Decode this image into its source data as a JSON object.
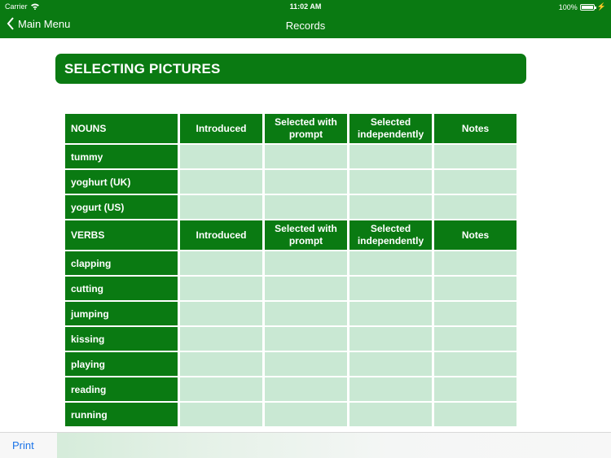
{
  "status": {
    "carrier": "Carrier",
    "time": "11:02 AM",
    "battery": "100%"
  },
  "nav": {
    "back_label": "Main Menu",
    "title": "Records"
  },
  "heading": "SELECTING PICTURES",
  "columns": [
    "Introduced",
    "Selected with prompt",
    "Selected independently",
    "Notes"
  ],
  "sections": [
    {
      "title": "NOUNS",
      "items": [
        "tummy",
        "yoghurt (UK)",
        "yogurt (US)"
      ]
    },
    {
      "title": "VERBS",
      "items": [
        "clapping",
        "cutting",
        "jumping",
        "kissing",
        "playing",
        "reading",
        "running"
      ]
    }
  ],
  "toolbar": {
    "print_label": "Print"
  },
  "colors": {
    "primary": "#0a7a12",
    "cell": "#c9e8d3",
    "link": "#1a73e8"
  }
}
